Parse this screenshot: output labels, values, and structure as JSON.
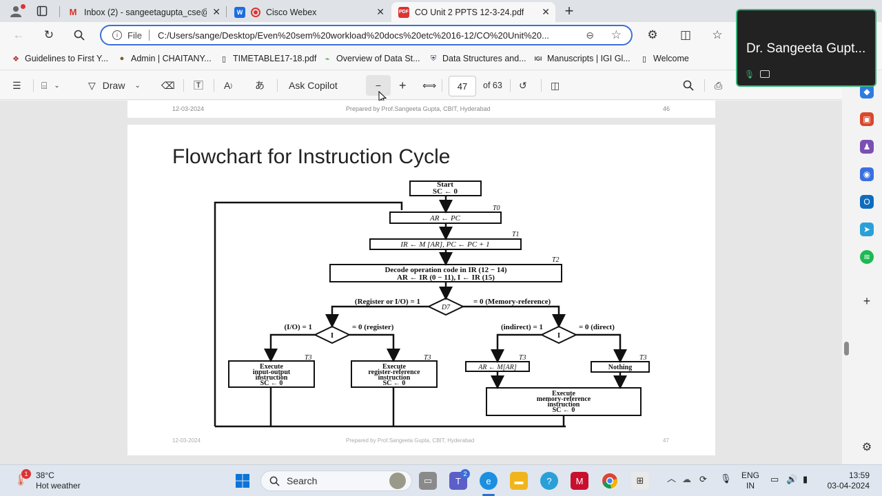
{
  "tabs": [
    {
      "title": "Inbox (2) - sangeetagupta_cse@c",
      "icon": "gmail-icon"
    },
    {
      "title": "Cisco Webex",
      "icon": "webex-icon"
    },
    {
      "title": "CO Unit 2 PPTS 12-3-24.pdf",
      "icon": "pdf-icon"
    }
  ],
  "address": {
    "scheme_label": "File",
    "url": "C:/Users/sange/Desktop/Even%20sem%20workload%20docs%20etc%2016-12/CO%20Unit%20..."
  },
  "favorites": [
    "Guidelines to First Y...",
    "Admin | CHAITANY...",
    "TIMETABLE17-18.pdf",
    "Overview of Data St...",
    "Data Structures and...",
    "Manuscripts | IGI Gl...",
    "Welcome"
  ],
  "pdf_toolbar": {
    "draw": "Draw",
    "copilot": "Ask Copilot",
    "page": "47",
    "page_of": "of 63"
  },
  "prev_page": {
    "date": "12-03-2024",
    "credit": "Prepared by Prof.Sangeeta Gupta, CBIT, Hyderabad",
    "number": "46"
  },
  "slide": {
    "title": "Flowchart for Instruction Cycle",
    "footer_date": "12-03-2024",
    "footer_credit": "Prepared by Prof.Sangeeta Gupta, CBIT, Hyderabad",
    "footer_number": "47"
  },
  "flowchart": {
    "start1": "Start",
    "start2": "SC ← 0",
    "t0": "T0",
    "box1": "AR ← PC",
    "t1": "T1",
    "box2": "IR ← M [AR],  PC ← PC + 1",
    "t2": "T2",
    "box3a": "Decode operation code in IR (12 − 14)",
    "box3b": "AR ← IR (0 − 11),  I ← IR (15)",
    "d7": "D7",
    "d7_left": "(Register or I/O)   = 1",
    "d7_right": "= 0   (Memory-reference)",
    "i_left": "I",
    "i_left_l": "(I/O)   = 1",
    "i_left_r": "= 0   (register)",
    "i_right": "I",
    "i_right_l": "(indirect)   = 1",
    "i_right_r": "= 0   (direct)",
    "t3": "T3",
    "io1": "Execute",
    "io2": "input-output",
    "io3": "instruction",
    "io4": "SC ← 0",
    "rr1": "Execute",
    "rr2": "register-reference",
    "rr3": "instruction",
    "rr4": "SC ← 0",
    "ind": "AR ← M[AR]",
    "nothing": "Nothing",
    "mr1": "Execute",
    "mr2": "memory-reference",
    "mr3": "instruction",
    "mr4": "SC ← 0"
  },
  "video": {
    "name": "Dr. Sangeeta Gupt..."
  },
  "taskbar": {
    "temp": "38°C",
    "weather": "Hot weather",
    "weather_badge": "1",
    "search": "Search",
    "teams_badge": "2",
    "lang1": "ENG",
    "lang2": "IN",
    "time": "13:59",
    "date": "03-04-2024"
  }
}
